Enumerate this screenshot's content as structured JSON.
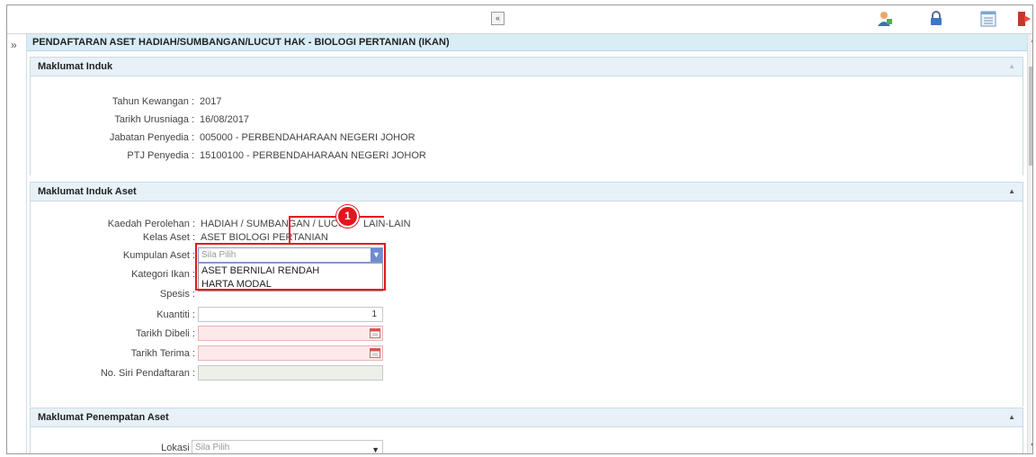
{
  "page_title": "PENDAFTARAN ASET HADIAH/SUMBANGAN/LUCUT HAK - BIOLOGI PERTANIAN (IKAN)",
  "toolbar": {
    "collapse_glyph": "«",
    "icons": [
      "user-icon",
      "lock-icon",
      "list-icon",
      "logout-icon"
    ]
  },
  "sidebar": {
    "toggle_glyph": "»"
  },
  "section_induk": {
    "header": "Maklumat Induk",
    "fields": [
      {
        "label": "Tahun Kewangan :",
        "value": "2017"
      },
      {
        "label": "Tarikh Urusniaga :",
        "value": "16/08/2017"
      },
      {
        "label": "Jabatan Penyedia :",
        "value": "005000 - PERBENDAHARAAN NEGERI JOHOR"
      },
      {
        "label": "PTJ Penyedia :",
        "value": "15100100 - PERBENDAHARAAN NEGERI JOHOR"
      }
    ]
  },
  "section_aset": {
    "header": "Maklumat Induk Aset",
    "kaedah_label": "Kaedah Perolehan :",
    "kaedah_value_left": "HADIAH / SUMBANGAN / LUCUT",
    "kaedah_value_right": "LAIN-LAIN",
    "kelas_label": "Kelas Aset :",
    "kelas_value": "ASET BIOLOGI PERTANIAN",
    "kumpulan_label": "Kumpulan Aset :",
    "kumpulan_selected": "Sila Pilih",
    "kumpulan_options": [
      "ASET BERNILAI RENDAH",
      "HARTA MODAL"
    ],
    "kategori_label": "Kategori Ikan :",
    "spesis_label": "Spesis :",
    "kuantiti_label": "Kuantiti :",
    "kuantiti_value": "1",
    "tarikh_dibeli_label": "Tarikh Dibeli :",
    "tarikh_terima_label": "Tarikh Terima :",
    "no_siri_label": "No. Siri Pendaftaran :"
  },
  "section_penempatan": {
    "header": "Maklumat Penempatan Aset",
    "lokasi_label": "Lokasi :",
    "lokasi_selected": "Sila Pilih"
  },
  "annotation": {
    "step_number": "1"
  },
  "colors": {
    "header_bg": "#d9edf7",
    "required_bg": "#fde9e9",
    "highlight": "#e3151f"
  }
}
